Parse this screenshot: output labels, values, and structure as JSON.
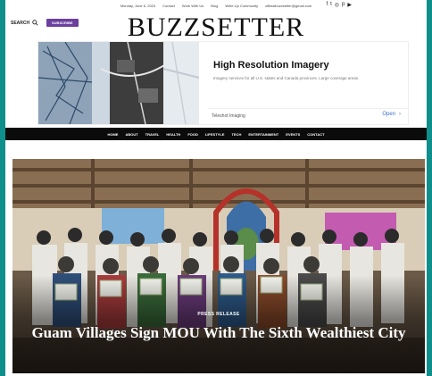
{
  "topbar": {
    "date": "Monday, June 6, 2023",
    "links": [
      "Contact",
      "Work With Us",
      "Blog",
      "Write Up Community",
      "officialbuzzsetter@gmail.com"
    ],
    "social_icons": [
      "facebook-icon",
      "twitter-icon",
      "instagram-icon",
      "pinterest-icon",
      "youtube-icon"
    ]
  },
  "header": {
    "search_label": "SEARCH",
    "subscribe_label": "SUBSCRIBE",
    "logo_text": "BUZZSETTER"
  },
  "ad": {
    "title": "High Resolution Imagery",
    "description": "Imagery services for all U.S. states and Canada provinces. Large coverage areas.",
    "brand": "Teleshot Imaging",
    "cta": "Open",
    "cta_icon": "chevron-right-icon"
  },
  "nav": {
    "items": [
      "HOME",
      "ABOUT",
      "TRAVEL",
      "HEALTH",
      "FOOD",
      "LIFESTYLE",
      "TECH",
      "ENTERTAINMENT",
      "EVENTS",
      "CONTACT"
    ]
  },
  "hero": {
    "category": "PRESS RELEASE",
    "headline": "Guam Villages Sign MOU With The Sixth Wealthiest City"
  },
  "colors": {
    "background_frame": "#0f8f8c",
    "subscribe_bg": "#6c3f9e",
    "nav_bg": "#0b0b0b",
    "ad_link": "#3a73c9"
  }
}
